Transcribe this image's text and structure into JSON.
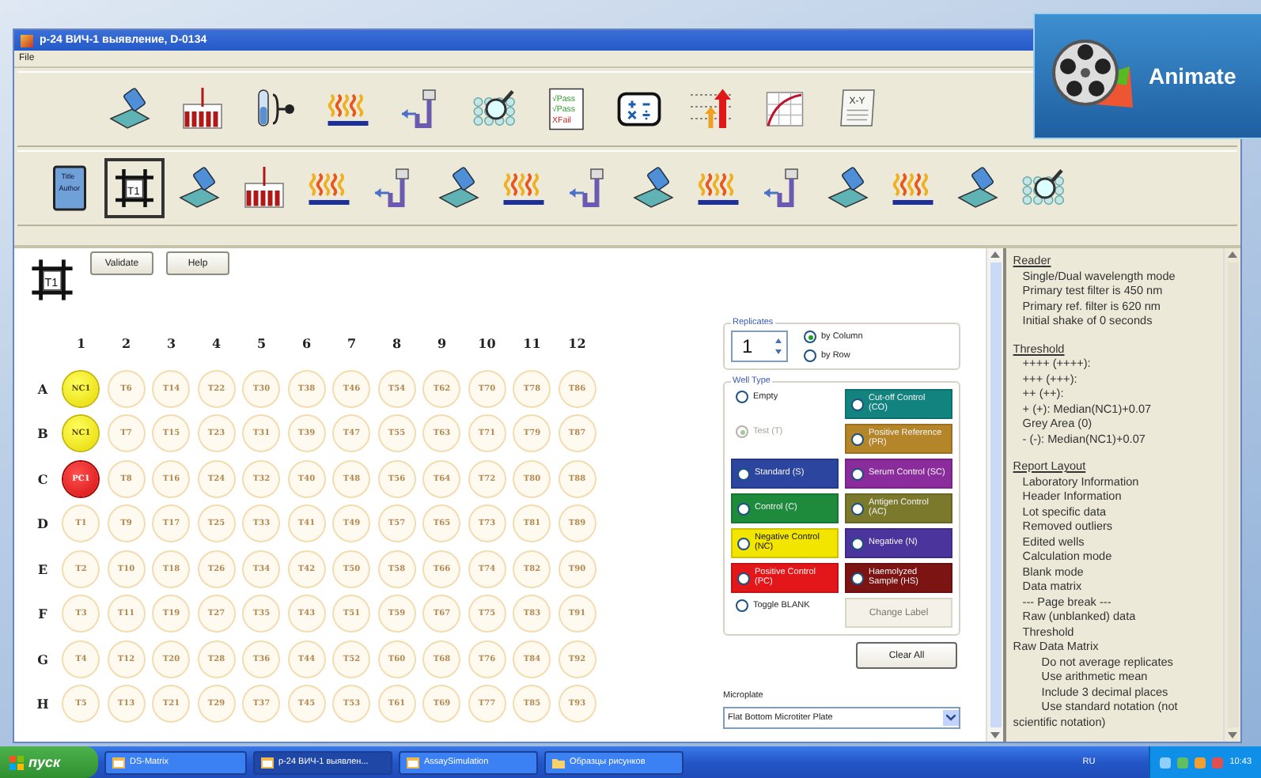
{
  "badge": {
    "label": "Animate"
  },
  "window": {
    "title": "p-24 ВИЧ-1 выявление, D-0134"
  },
  "menu": [
    "File"
  ],
  "toolbar_1": [
    {
      "kind": "dispense"
    },
    {
      "kind": "rack"
    },
    {
      "kind": "tube"
    },
    {
      "kind": "incubate"
    },
    {
      "kind": "wash"
    },
    {
      "kind": "read"
    },
    {
      "kind": "passfail",
      "text": [
        "√Pass",
        "√Pass",
        "XFail"
      ]
    },
    {
      "kind": "calc"
    },
    {
      "kind": "threshold"
    },
    {
      "kind": "curve"
    },
    {
      "kind": "xy",
      "text": [
        "X-Y"
      ]
    }
  ],
  "toolbar_2": [
    {
      "kind": "title",
      "text": [
        "Title",
        "Author"
      ],
      "selected": false
    },
    {
      "kind": "grid",
      "text": [
        "T1"
      ],
      "selected": true
    },
    {
      "kind": "dispense",
      "selected": false
    },
    {
      "kind": "rack",
      "selected": false
    },
    {
      "kind": "incubate",
      "selected": false
    },
    {
      "kind": "wash",
      "selected": false
    },
    {
      "kind": "dispense",
      "selected": false
    },
    {
      "kind": "incubate",
      "selected": false
    },
    {
      "kind": "wash",
      "selected": false
    },
    {
      "kind": "dispense",
      "selected": false
    },
    {
      "kind": "incubate",
      "selected": false
    },
    {
      "kind": "wash",
      "selected": false
    },
    {
      "kind": "dispense",
      "selected": false
    },
    {
      "kind": "incubate",
      "selected": false
    },
    {
      "kind": "dispense",
      "selected": false
    },
    {
      "kind": "read",
      "selected": false
    }
  ],
  "plate_header": {
    "icon_text": "T1",
    "buttons": [
      "Validate",
      "Help"
    ]
  },
  "plate": {
    "columns": [
      "1",
      "2",
      "3",
      "4",
      "5",
      "6",
      "7",
      "8",
      "9",
      "10",
      "11",
      "12"
    ],
    "rows": [
      {
        "label": "A",
        "wells": [
          {
            "label": "NC1",
            "kind": "nc"
          },
          {
            "label": "T6",
            "kind": "test"
          },
          {
            "label": "T14",
            "kind": "test"
          },
          {
            "label": "T22",
            "kind": "test"
          },
          {
            "label": "T30",
            "kind": "test"
          },
          {
            "label": "T38",
            "kind": "test"
          },
          {
            "label": "T46",
            "kind": "test"
          },
          {
            "label": "T54",
            "kind": "test"
          },
          {
            "label": "T62",
            "kind": "test"
          },
          {
            "label": "T70",
            "kind": "test"
          },
          {
            "label": "T78",
            "kind": "test"
          },
          {
            "label": "T86",
            "kind": "test"
          }
        ]
      },
      {
        "label": "B",
        "wells": [
          {
            "label": "NC1",
            "kind": "nc"
          },
          {
            "label": "T7",
            "kind": "test"
          },
          {
            "label": "T15",
            "kind": "test"
          },
          {
            "label": "T23",
            "kind": "test"
          },
          {
            "label": "T31",
            "kind": "test"
          },
          {
            "label": "T39",
            "kind": "test"
          },
          {
            "label": "T47",
            "kind": "test"
          },
          {
            "label": "T55",
            "kind": "test"
          },
          {
            "label": "T63",
            "kind": "test"
          },
          {
            "label": "T71",
            "kind": "test"
          },
          {
            "label": "T79",
            "kind": "test"
          },
          {
            "label": "T87",
            "kind": "test"
          }
        ]
      },
      {
        "label": "C",
        "wells": [
          {
            "label": "PC1",
            "kind": "pc"
          },
          {
            "label": "T8",
            "kind": "test"
          },
          {
            "label": "T16",
            "kind": "test"
          },
          {
            "label": "T24",
            "kind": "test"
          },
          {
            "label": "T32",
            "kind": "test"
          },
          {
            "label": "T40",
            "kind": "test"
          },
          {
            "label": "T48",
            "kind": "test"
          },
          {
            "label": "T56",
            "kind": "test"
          },
          {
            "label": "T64",
            "kind": "test"
          },
          {
            "label": "T72",
            "kind": "test"
          },
          {
            "label": "T80",
            "kind": "test"
          },
          {
            "label": "T88",
            "kind": "test"
          }
        ]
      },
      {
        "label": "D",
        "wells": [
          {
            "label": "T1",
            "kind": "test"
          },
          {
            "label": "T9",
            "kind": "test"
          },
          {
            "label": "T17",
            "kind": "test"
          },
          {
            "label": "T25",
            "kind": "test"
          },
          {
            "label": "T33",
            "kind": "test"
          },
          {
            "label": "T41",
            "kind": "test"
          },
          {
            "label": "T49",
            "kind": "test"
          },
          {
            "label": "T57",
            "kind": "test"
          },
          {
            "label": "T65",
            "kind": "test"
          },
          {
            "label": "T73",
            "kind": "test"
          },
          {
            "label": "T81",
            "kind": "test"
          },
          {
            "label": "T89",
            "kind": "test"
          }
        ]
      },
      {
        "label": "E",
        "wells": [
          {
            "label": "T2",
            "kind": "test"
          },
          {
            "label": "T10",
            "kind": "test"
          },
          {
            "label": "T18",
            "kind": "test"
          },
          {
            "label": "T26",
            "kind": "test"
          },
          {
            "label": "T34",
            "kind": "test"
          },
          {
            "label": "T42",
            "kind": "test"
          },
          {
            "label": "T50",
            "kind": "test"
          },
          {
            "label": "T58",
            "kind": "test"
          },
          {
            "label": "T66",
            "kind": "test"
          },
          {
            "label": "T74",
            "kind": "test"
          },
          {
            "label": "T82",
            "kind": "test"
          },
          {
            "label": "T90",
            "kind": "test"
          }
        ]
      },
      {
        "label": "F",
        "wells": [
          {
            "label": "T3",
            "kind": "test"
          },
          {
            "label": "T11",
            "kind": "test"
          },
          {
            "label": "T19",
            "kind": "test"
          },
          {
            "label": "T27",
            "kind": "test"
          },
          {
            "label": "T35",
            "kind": "test"
          },
          {
            "label": "T43",
            "kind": "test"
          },
          {
            "label": "T51",
            "kind": "test"
          },
          {
            "label": "T59",
            "kind": "test"
          },
          {
            "label": "T67",
            "kind": "test"
          },
          {
            "label": "T75",
            "kind": "test"
          },
          {
            "label": "T83",
            "kind": "test"
          },
          {
            "label": "T91",
            "kind": "test"
          }
        ]
      },
      {
        "label": "G",
        "wells": [
          {
            "label": "T4",
            "kind": "test"
          },
          {
            "label": "T12",
            "kind": "test"
          },
          {
            "label": "T20",
            "kind": "test"
          },
          {
            "label": "T28",
            "kind": "test"
          },
          {
            "label": "T36",
            "kind": "test"
          },
          {
            "label": "T44",
            "kind": "test"
          },
          {
            "label": "T52",
            "kind": "test"
          },
          {
            "label": "T60",
            "kind": "test"
          },
          {
            "label": "T68",
            "kind": "test"
          },
          {
            "label": "T76",
            "kind": "test"
          },
          {
            "label": "T84",
            "kind": "test"
          },
          {
            "label": "T92",
            "kind": "test"
          }
        ]
      },
      {
        "label": "H",
        "wells": [
          {
            "label": "T5",
            "kind": "test"
          },
          {
            "label": "T13",
            "kind": "test"
          },
          {
            "label": "T21",
            "kind": "test"
          },
          {
            "label": "T29",
            "kind": "test"
          },
          {
            "label": "T37",
            "kind": "test"
          },
          {
            "label": "T45",
            "kind": "test"
          },
          {
            "label": "T53",
            "kind": "test"
          },
          {
            "label": "T61",
            "kind": "test"
          },
          {
            "label": "T69",
            "kind": "test"
          },
          {
            "label": "T77",
            "kind": "test"
          },
          {
            "label": "T85",
            "kind": "test"
          },
          {
            "label": "T93",
            "kind": "test"
          }
        ]
      }
    ]
  },
  "replicates": {
    "title": "Replicates",
    "value": "1",
    "options": [
      {
        "label": "by Column",
        "selected": true
      },
      {
        "label": "by Row",
        "selected": false
      }
    ]
  },
  "well_type": {
    "title": "Well Type",
    "items": [
      {
        "kind": "radio",
        "label": "Empty",
        "selected": false,
        "disabled": false
      },
      {
        "kind": "colored",
        "label": "Cut-off Control (CO)",
        "color": "#12837f",
        "selected": false
      },
      {
        "kind": "radio",
        "label": "Test (T)",
        "selected": true,
        "disabled": true
      },
      {
        "kind": "colored",
        "label": "Positive Reference (PR)",
        "color": "#b5852a",
        "selected": false
      },
      {
        "kind": "colored",
        "label": "Standard (S)",
        "color": "#2c46a0",
        "selected": false
      },
      {
        "kind": "colored",
        "label": "Serum Control (SC)",
        "color": "#8b2c9c",
        "selected": false
      },
      {
        "kind": "colored",
        "label": "Control (C)",
        "color": "#1d8a3c",
        "selected": false
      },
      {
        "kind": "colored",
        "label": "Antigen Control (AC)",
        "color": "#7b7a2c",
        "selected": false
      },
      {
        "kind": "colored",
        "label": "Negative Control (NC)",
        "color": "#f2e600",
        "selected": false
      },
      {
        "kind": "colored",
        "label": "Negative (N)",
        "color": "#4b349c",
        "selected": false
      },
      {
        "kind": "colored",
        "label": "Positive Control (PC)",
        "color": "#e3161a",
        "selected": false
      },
      {
        "kind": "colored",
        "label": "Haemolyzed Sample (HS)",
        "color": "#7c1414",
        "selected": false
      },
      {
        "kind": "radio",
        "label": "Toggle BLANK",
        "selected": false,
        "disabled": false
      },
      {
        "kind": "button",
        "label": "Change Label"
      }
    ]
  },
  "clear_button": "Clear All",
  "microplate": {
    "label": "Microplate",
    "value": "Flat Bottom Microtiter Plate"
  },
  "report": [
    {
      "kind": "heading",
      "text": "Reader"
    },
    {
      "kind": "item",
      "text": "Single/Dual wavelength mode"
    },
    {
      "kind": "item",
      "text": "Primary test filter is 450 nm"
    },
    {
      "kind": "item",
      "text": "Primary ref. filter is 620 nm"
    },
    {
      "kind": "item",
      "text": "Initial shake of 0 seconds"
    },
    {
      "kind": "heading",
      "text": "Threshold"
    },
    {
      "kind": "item",
      "text": "++++ (++++):"
    },
    {
      "kind": "item",
      "text": "+++ (+++):"
    },
    {
      "kind": "item",
      "text": "++ (++):"
    },
    {
      "kind": "item",
      "text": "+ (+): Median(NC1)+0.07"
    },
    {
      "kind": "item",
      "text": "Grey Area (0)"
    },
    {
      "kind": "item",
      "text": "- (-): Median(NC1)+0.07"
    },
    {
      "kind": "heading",
      "text": "Report Layout"
    },
    {
      "kind": "item",
      "text": "Laboratory Information"
    },
    {
      "kind": "item",
      "text": "Header Information"
    },
    {
      "kind": "item",
      "text": "Lot specific data"
    },
    {
      "kind": "item",
      "text": "Removed outliers"
    },
    {
      "kind": "item",
      "text": "Edited wells"
    },
    {
      "kind": "item",
      "text": "Calculation mode"
    },
    {
      "kind": "item",
      "text": "Blank mode"
    },
    {
      "kind": "item",
      "text": "Data matrix"
    },
    {
      "kind": "item",
      "text": "--- Page break ---"
    },
    {
      "kind": "item",
      "text": "Raw (unblanked) data"
    },
    {
      "kind": "item",
      "text": "Threshold"
    },
    {
      "kind": "group",
      "text": "Raw Data Matrix"
    },
    {
      "kind": "sub",
      "text": "Do not average replicates"
    },
    {
      "kind": "sub",
      "text": "Use arithmetic mean"
    },
    {
      "kind": "sub",
      "text": "Include 3 decimal places"
    },
    {
      "kind": "sub",
      "text": "Use standard notation (not"
    },
    {
      "kind": "cont",
      "text": "scientific notation)"
    }
  ],
  "taskbar": {
    "start": "пуск",
    "tasks": [
      {
        "label": "DS-Matrix",
        "selected": false
      },
      {
        "label": "p-24 ВИЧ-1 выявлен...",
        "selected": true
      },
      {
        "label": "AssaySimulation",
        "selected": false
      },
      {
        "label": "Образцы рисунков",
        "selected": false,
        "kind": "folder"
      }
    ],
    "language": "RU",
    "clock": "10:43"
  }
}
